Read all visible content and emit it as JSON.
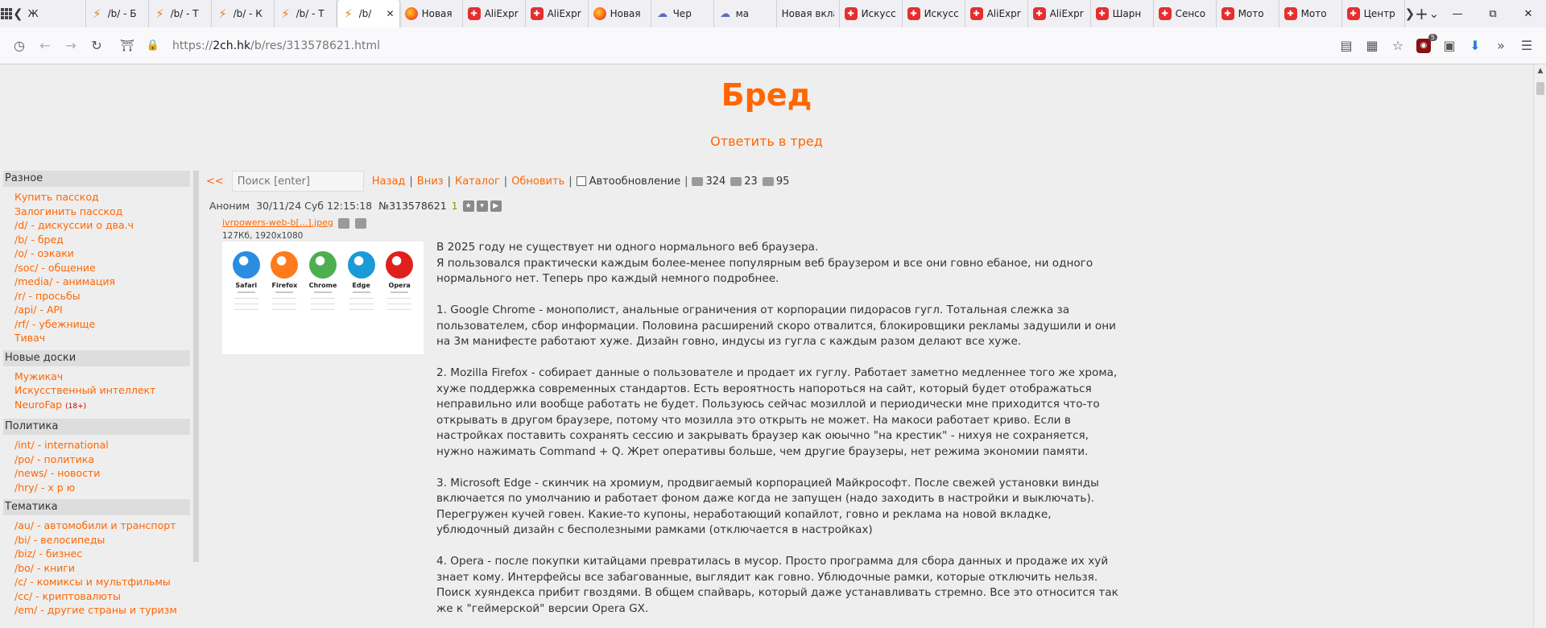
{
  "tabs": [
    {
      "label": "Ж",
      "icon": "letter-icon",
      "kind": "plain"
    },
    {
      "label": "/b/ - Б",
      "icon": "bolt-icon",
      "kind": "bolt"
    },
    {
      "label": "/b/ - Т",
      "icon": "bolt-icon",
      "kind": "bolt"
    },
    {
      "label": "/b/ - К",
      "icon": "bolt-icon",
      "kind": "bolt"
    },
    {
      "label": "/b/ - Т",
      "icon": "bolt-icon",
      "kind": "bolt"
    },
    {
      "label": "/b/",
      "icon": "bolt-icon",
      "kind": "bolt",
      "active": true
    },
    {
      "label": "Новая",
      "icon": "firefox-icon",
      "kind": "ff"
    },
    {
      "label": "AliExpr",
      "icon": "aliexpress-icon",
      "kind": "ali"
    },
    {
      "label": "AliExpr",
      "icon": "aliexpress-icon",
      "kind": "ali"
    },
    {
      "label": "Новая",
      "icon": "firefox-icon",
      "kind": "ff"
    },
    {
      "label": "Чер",
      "icon": "globe-icon",
      "kind": "gl"
    },
    {
      "label": "ма",
      "icon": "globe-icon",
      "kind": "gl"
    },
    {
      "label": "Новая вкла",
      "icon": "",
      "kind": "plain"
    },
    {
      "label": "Искусс",
      "icon": "aliexpress-icon",
      "kind": "ali"
    },
    {
      "label": "Искусс",
      "icon": "aliexpress-icon",
      "kind": "ali"
    },
    {
      "label": "AliExpr",
      "icon": "aliexpress-icon",
      "kind": "ali"
    },
    {
      "label": "AliExpr",
      "icon": "aliexpress-icon",
      "kind": "ali"
    },
    {
      "label": "Шарн",
      "icon": "aliexpress-icon",
      "kind": "ali"
    },
    {
      "label": "Сенсо",
      "icon": "aliexpress-icon",
      "kind": "ali"
    },
    {
      "label": "Мото",
      "icon": "aliexpress-icon",
      "kind": "ali"
    },
    {
      "label": "Мото",
      "icon": "aliexpress-icon",
      "kind": "ali"
    },
    {
      "label": "Центр",
      "icon": "aliexpress-icon",
      "kind": "ali"
    }
  ],
  "address": {
    "prefix": "https://",
    "host": "2ch.hk",
    "path": "/b/res/313578621.html"
  },
  "extension_badge": "5",
  "board_title": "Бред",
  "reply_link": "Ответить в тред",
  "menu": [
    {
      "title": "Разное",
      "items": [
        {
          "label": "Купить пасскод"
        },
        {
          "label": "Залогинить пасскод"
        },
        {
          "label": "/d/ - дискуссии о два.ч"
        },
        {
          "label": "/b/ - бред"
        },
        {
          "label": "/o/ - оэкаки"
        },
        {
          "label": "/soc/ - общение"
        },
        {
          "label": "/media/ - анимация"
        },
        {
          "label": "/r/ - просьбы"
        },
        {
          "label": "/api/ - API"
        },
        {
          "label": "/rf/ - убежнище"
        },
        {
          "label": "Тивач"
        }
      ]
    },
    {
      "title": "Новые доски",
      "items": [
        {
          "label": "Мужикач"
        },
        {
          "label": "Искусственный интеллект"
        },
        {
          "label": "NeuroFap",
          "tag": "(18+)"
        }
      ]
    },
    {
      "title": "Политика",
      "items": [
        {
          "label": "/int/ - international"
        },
        {
          "label": "/po/ - политика"
        },
        {
          "label": "/news/ - новости"
        },
        {
          "label": "/hry/ - х р ю"
        }
      ]
    },
    {
      "title": "Тематика",
      "items": [
        {
          "label": "/au/ - автомобили и транспорт"
        },
        {
          "label": "/bi/ - велосипеды"
        },
        {
          "label": "/biz/ - бизнес"
        },
        {
          "label": "/bo/ - книги"
        },
        {
          "label": "/c/ - комиксы и мультфильмы"
        },
        {
          "label": "/cc/ - криптовалюты"
        },
        {
          "label": "/em/ - другие страны и туризм"
        }
      ]
    }
  ],
  "toolbar": {
    "back_arrows": "<<",
    "search_placeholder": "Поиск [enter]",
    "back": "Назад",
    "down": "Вниз",
    "catalog": "Каталог",
    "refresh": "Обновить",
    "autoupdate": "Автообновление",
    "posts_count": "324",
    "images_count": "23",
    "users_count": "95"
  },
  "post": {
    "author": "Аноним",
    "datetime": "30/11/24 Суб 12:15:18",
    "number": "№313578621",
    "reply_count": "1",
    "file_name": "ivrpowers-web-b[...].jpeg",
    "file_meta": "127Кб, 1920x1080",
    "thumb_browsers": [
      {
        "name": "Safari",
        "icon": "safari-icon",
        "color": "#2b8de0"
      },
      {
        "name": "Firefox",
        "icon": "firefox-icon",
        "color": "#ff7a1a"
      },
      {
        "name": "Chrome",
        "icon": "chrome-icon",
        "color": "#4caf50"
      },
      {
        "name": "Edge",
        "icon": "edge-icon",
        "color": "#1a9ad8"
      },
      {
        "name": "Opera",
        "icon": "opera-icon",
        "color": "#e0201a"
      }
    ],
    "paragraphs": [
      "В 2025 году не существует ни одного нормального веб браузера.\nЯ пользовался практически каждым более-менее популярным веб браузером и все они говно ебаное, ни одного нормального нет. Теперь про каждый немного подробнее.",
      "1. Google Chrome - монополист, анальные ограничения от корпорации пидорасов гугл. Тотальная слежка за пользователем, сбор информации. Половина расширений скоро отвалится, блокировщики рекламы задушили и они на 3м манифесте работают хуже. Дизайн говно, индусы из гугла с каждым разом делают все хуже.",
      "2. Mozilla Firefox - собирает данные о пользователе и продает их гуглу. Работает заметно медленнее того же хрома, хуже поддержка современных стандартов. Есть вероятность напороться на сайт, который будет отображаться неправильно или вообще работать не будет. Пользуюсь сейчас мозиллой и периодически мне приходится что-то открывать в другом браузере, потому что мозилла это открыть не может. На макоси работает криво. Если в настройках поставить сохранять сессию и закрывать браузер как оюычно \"на крестик\" - нихуя не сохраняется, нужно нажимать Command + Q. Жрет оперативы больше, чем другие браузеры, нет режима экономии памяти.",
      "3. Microsoft Edge - скинчик на хромиум, продвигаемый корпорацией Майкрософт. После свежей установки винды включается по умолчанию и работает фоном даже когда не запущен (надо заходить в настройки и выключать). Перегружен кучей говен. Какие-то купоны, неработающий копайлот, говно и реклама на новой вкладке, ублюдочный дизайн с бесполезными рамками (отключается в настройках)",
      "4. Opera - после покупки китайцами превратилась в мусор. Просто программа для сбора данных и продаже их хуй знает кому. Интерфейсы все забагованные, выглядит как говно. Ублюдочные рамки, которые отключить нельзя. Поиск хуяндекса прибит гвоздями. В общем спайварь, который даже устанавливать стремно. Все это относится так же к \"геймерской\" версии Opera GX."
    ]
  }
}
